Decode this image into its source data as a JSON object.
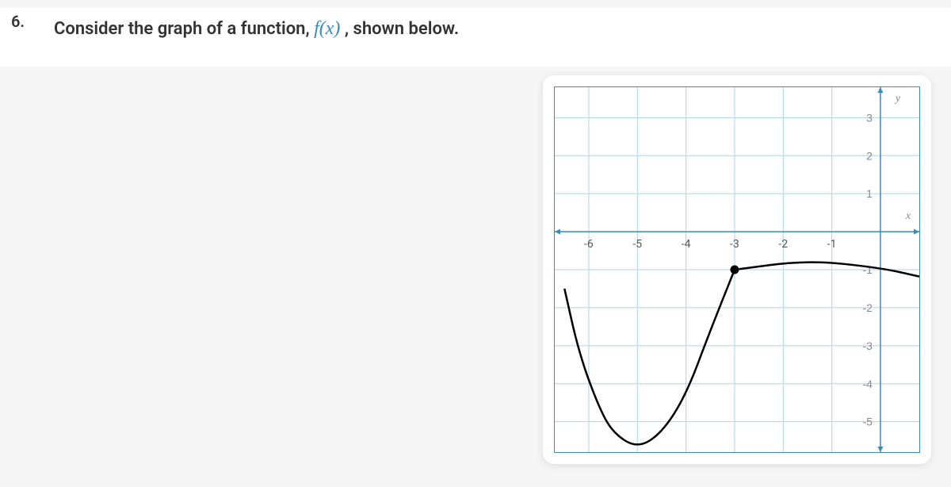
{
  "question": {
    "number": "6.",
    "text_before": "Consider the graph of a function, ",
    "math": "f(x)",
    "text_after": ", shown below."
  },
  "chart_data": {
    "type": "line",
    "xlabel": "x",
    "ylabel": "y",
    "x_ticks": [
      -6,
      -5,
      -4,
      -3,
      -2,
      -1
    ],
    "y_ticks": [
      3,
      2,
      1,
      -1,
      -2,
      -3,
      -4,
      -5
    ],
    "xlim": [
      -6.7,
      0.8
    ],
    "ylim": [
      -5.8,
      3.8
    ],
    "colors": {
      "grid": "#aed3e6",
      "axis": "#3a8bbb",
      "curve": "#000000"
    },
    "curve1": {
      "description": "parabola-like opening up",
      "points": [
        {
          "x": -6.5,
          "y": -1.5
        },
        {
          "x": -6.2,
          "y": -3.2
        },
        {
          "x": -5.8,
          "y": -4.6
        },
        {
          "x": -5.5,
          "y": -5.3
        },
        {
          "x": -5.0,
          "y": -5.7
        },
        {
          "x": -4.5,
          "y": -5.3
        },
        {
          "x": -4.0,
          "y": -4.3
        },
        {
          "x": -3.5,
          "y": -2.6
        },
        {
          "x": -3.0,
          "y": -1.0
        }
      ]
    },
    "filled_point": {
      "x": -3,
      "y": -1
    },
    "curve2": {
      "description": "slight arc from filled point to right edge",
      "points": [
        {
          "x": -3.0,
          "y": -1.0
        },
        {
          "x": -1.5,
          "y": -0.75
        },
        {
          "x": 0.0,
          "y": -0.95
        },
        {
          "x": 0.8,
          "y": -1.18
        }
      ]
    }
  }
}
